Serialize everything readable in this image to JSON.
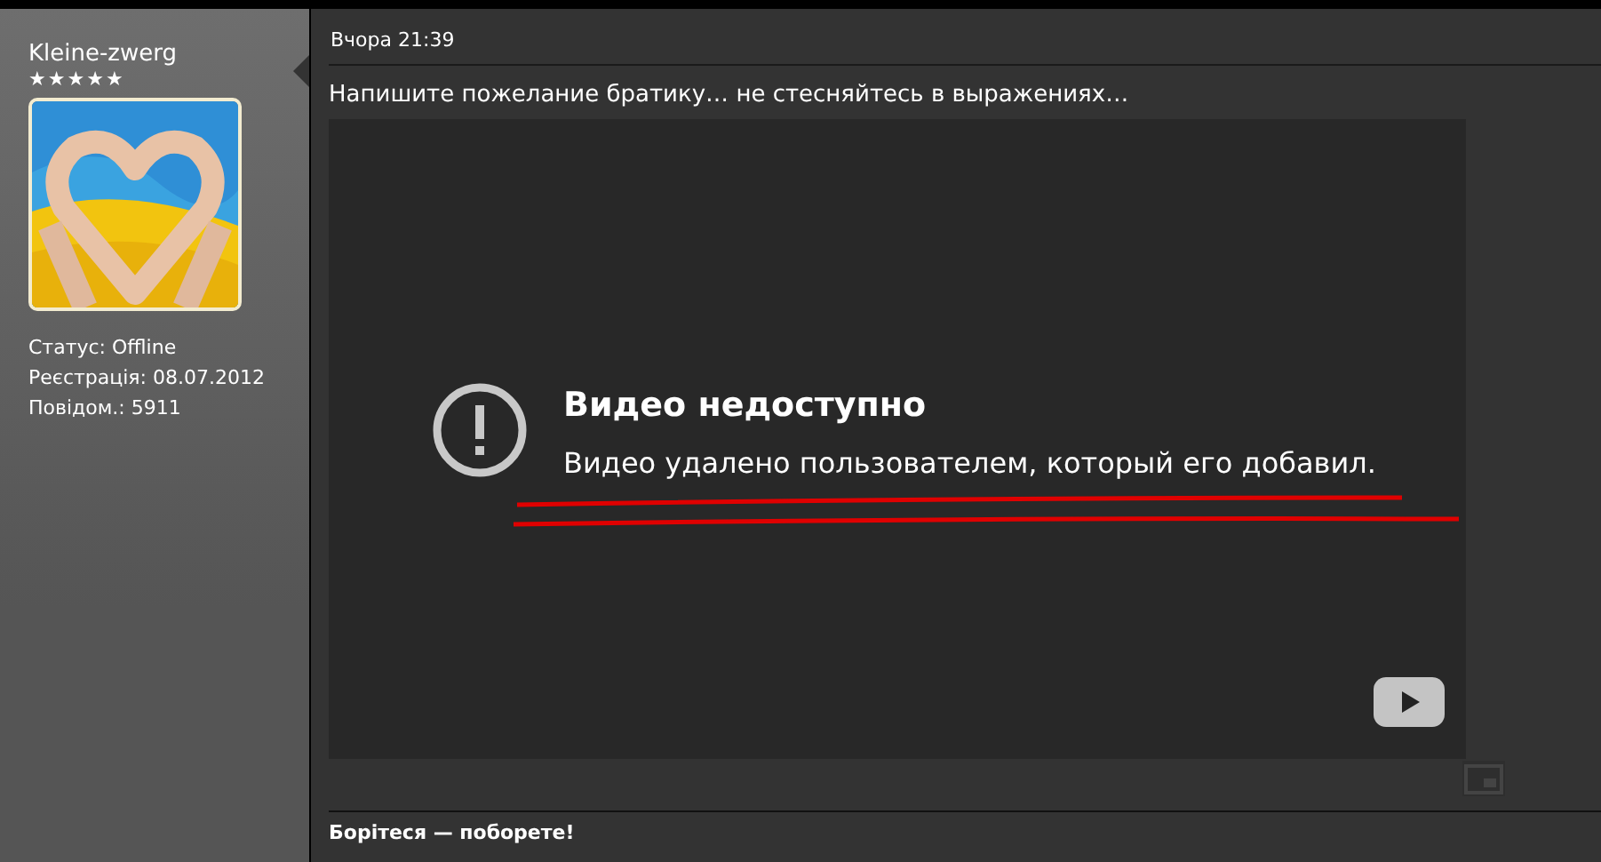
{
  "user": {
    "name": "Kleine-zwerg",
    "stars": 5,
    "info": [
      "Статус: Offline",
      "Реєстрація: 08.07.2012",
      "Повідом.: 5911"
    ]
  },
  "post": {
    "time": "Вчора 21:39",
    "text": "Напишите пожелание братику… не стесняйтесь в выражениях…",
    "video": {
      "title": "Видео недоступно",
      "message": "Видео удалено пользователем, который его добавил.",
      "annotated": true
    },
    "signature": "Борітеся — поборете!"
  }
}
